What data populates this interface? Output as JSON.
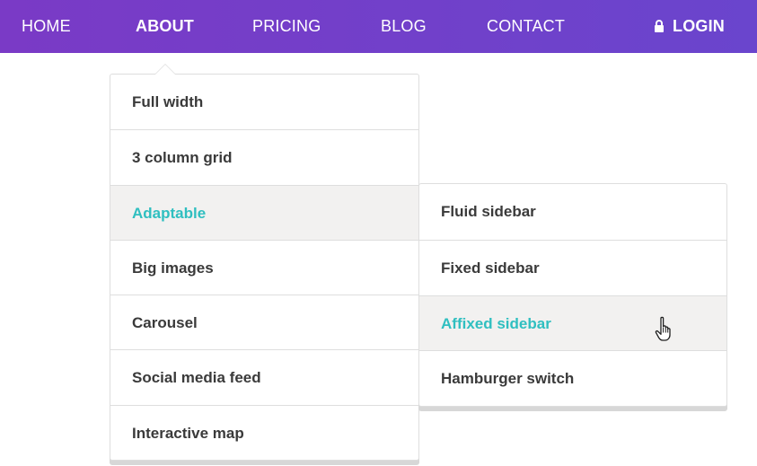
{
  "nav": {
    "items": [
      {
        "label": "HOME"
      },
      {
        "label": "ABOUT"
      },
      {
        "label": "PRICING"
      },
      {
        "label": "BLOG"
      },
      {
        "label": "CONTACT"
      }
    ],
    "login_label": "LOGIN",
    "login_icon": "lock-icon",
    "active": "ABOUT"
  },
  "dropdown": {
    "items": [
      {
        "label": "Full width"
      },
      {
        "label": "3 column grid"
      },
      {
        "label": "Adaptable"
      },
      {
        "label": "Big images"
      },
      {
        "label": "Carousel"
      },
      {
        "label": "Social media feed"
      },
      {
        "label": "Interactive map"
      }
    ],
    "selected": "Adaptable"
  },
  "submenu": {
    "items": [
      {
        "label": "Fluid sidebar"
      },
      {
        "label": "Fixed sidebar"
      },
      {
        "label": "Affixed sidebar"
      },
      {
        "label": "Hamburger switch"
      }
    ],
    "selected": "Affixed sidebar"
  },
  "colors": {
    "nav_bg_start": "#7a3ac6",
    "nav_bg_end": "#6a45cd",
    "accent": "#2fbfc0",
    "hover_bg": "#f2f1f0",
    "text": "#3a3a3a"
  },
  "cursor_icon": "hand-pointer-icon"
}
